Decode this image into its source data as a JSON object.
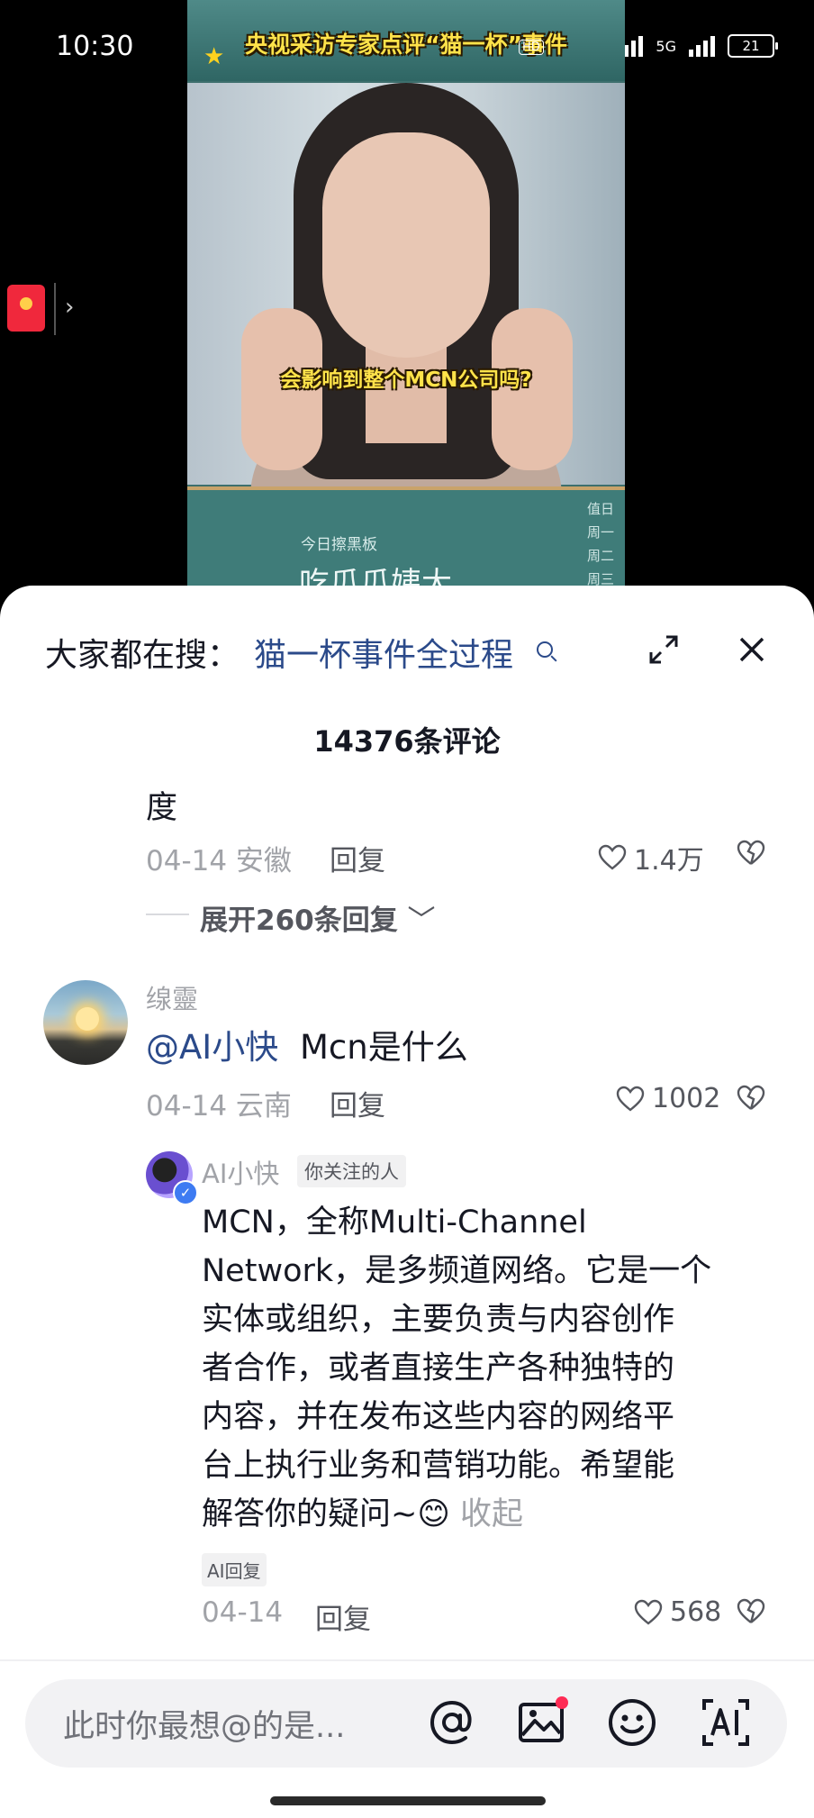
{
  "status_bar": {
    "time": "10:30",
    "network_1": "5G",
    "network_2": "5G",
    "battery": "21"
  },
  "video": {
    "banner_title": "央视采访专家点评“猫一杯”事件",
    "badge": "HD",
    "subtitle": "会影响到整个MCN公司吗?",
    "board_small": "今日擦黑板",
    "board_big": "吃瓜瓜姨大",
    "board_side": "值日\n周一\n周二\n周三"
  },
  "search_bar": {
    "prefix": "大家都在搜：",
    "term": "猫一杯事件全过程"
  },
  "comments_header": {
    "count_label": "14376条评论"
  },
  "comments": [
    {
      "text": "度",
      "date_location": "04-14 安徽",
      "reply_label": "回复",
      "likes": "1.4万",
      "expand_label": "展开260条回复"
    },
    {
      "username": "缐靈",
      "mention": "@AI小快",
      "text": "Mcn是什么",
      "date_location": "04-14 云南",
      "reply_label": "回复",
      "likes": "1002"
    }
  ],
  "ai_reply": {
    "username": "AI小快",
    "follow_badge": "你关注的人",
    "text": "MCN，全称Multi-Channel\nNetwork，是多频道网络。它是一个\n实体或组织，主要负责与内容创作\n者合作，或者直接生产各种独特的\n内容，并在发布这些内容的网络平\n台上执行业务和营销功能。希望能\n解答你的疑问~😊 ",
    "collapse_label": "收起",
    "ai_badge": "AI回复",
    "date": "04-14",
    "reply_label": "回复",
    "likes": "568"
  },
  "input_bar": {
    "placeholder": "此时你最想@的是..."
  },
  "colors": {
    "accent_blue": "#2b4a8a",
    "muted_gray": "#a1a3a8",
    "red_dot": "#fe2c55"
  }
}
